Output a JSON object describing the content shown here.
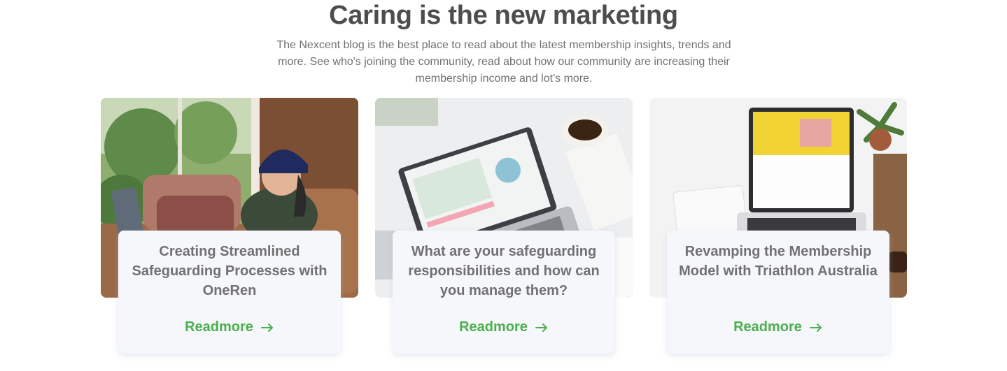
{
  "section": {
    "title": "Caring is the new marketing",
    "description": "The Nexcent blog is the best place to read about the latest membership insights, trends and more. See who's joining the community, read about how our community are increasing their membership income and lot's more."
  },
  "cards": [
    {
      "title": "Creating Streamlined Safeguarding Processes with OneRen",
      "cta": "Readmore",
      "cta_icon": "arrow-right-icon"
    },
    {
      "title": "What are your safeguarding responsibilities and how can you manage them?",
      "cta": "Readmore",
      "cta_icon": "arrow-right-icon"
    },
    {
      "title": "Revamping the Membership Model with Triathlon Australia",
      "cta": "Readmore",
      "cta_icon": "arrow-right-icon"
    }
  ],
  "colors": {
    "heading": "#4d4d4d",
    "body_text": "#717171",
    "accent": "#4caf4f",
    "card_bg": "#f5f7fa"
  }
}
